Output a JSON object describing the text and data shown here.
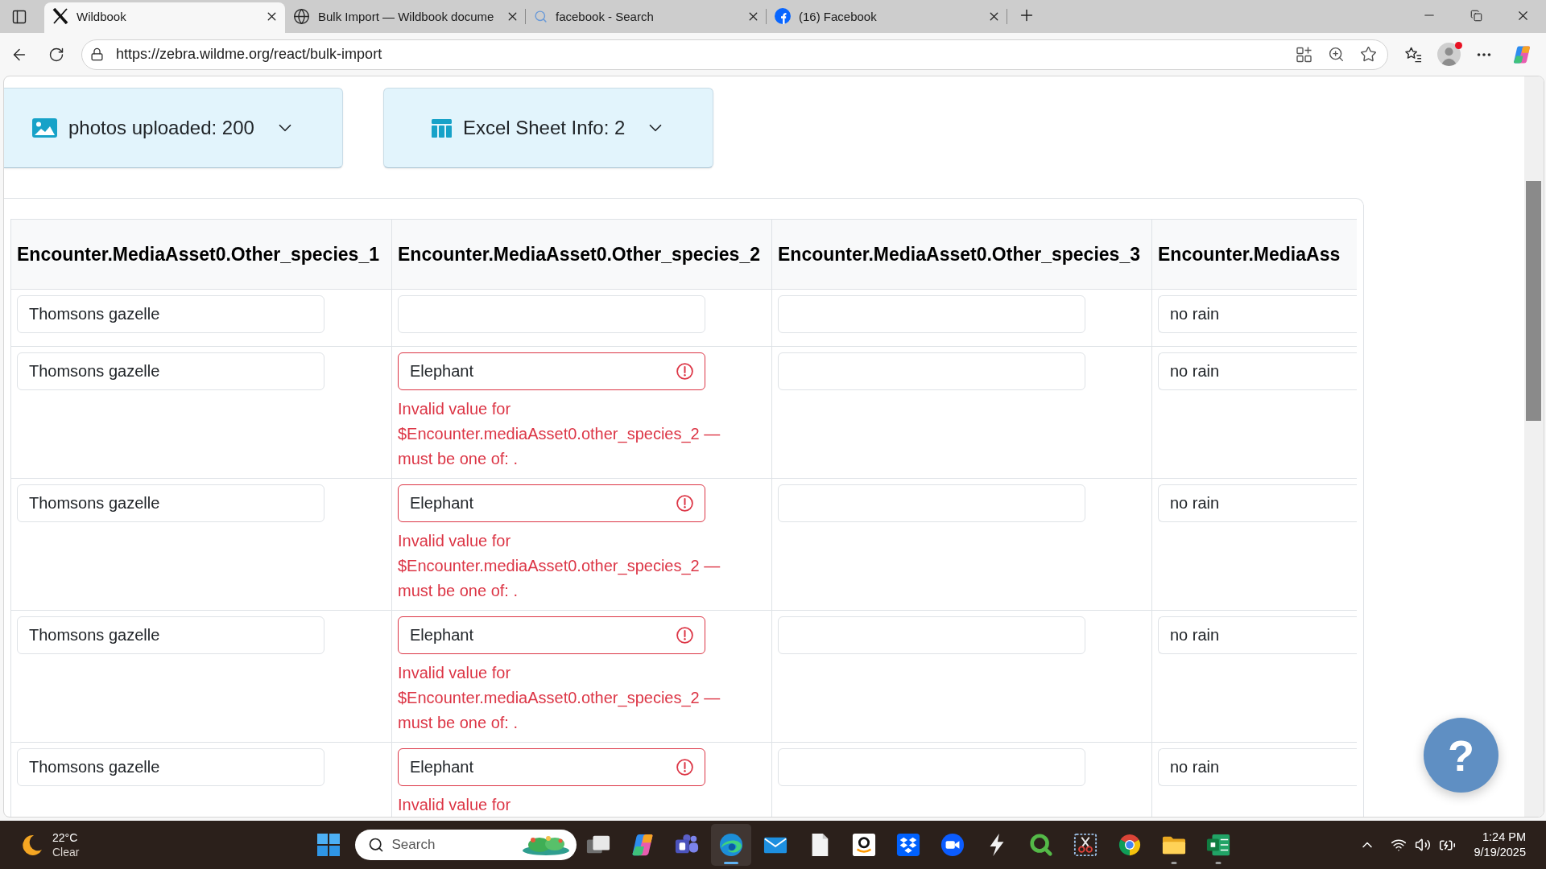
{
  "browser": {
    "tabs": [
      {
        "kind": "x",
        "title": "Wildbook",
        "selected": true
      },
      {
        "kind": "globe",
        "title": "Bulk Import — Wildbook docume",
        "selected": false
      },
      {
        "kind": "search",
        "title": "facebook - Search",
        "selected": false
      },
      {
        "kind": "facebook",
        "title": "(16) Facebook",
        "selected": false
      }
    ],
    "url": "https://zebra.wildme.org/react/bulk-import",
    "profile": {
      "notification": true
    }
  },
  "summary_cards": [
    {
      "kind": "photos",
      "label": "photos uploaded: 200",
      "expanded": false
    },
    {
      "kind": "sheet",
      "label": "Excel Sheet Info: 2",
      "expanded": false
    }
  ],
  "table": {
    "columns": [
      "Encounter.MediaAsset0.Other_species_1",
      "Encounter.MediaAsset0.Other_species_2",
      "Encounter.MediaAsset0.Other_species_3",
      "Encounter.MediaAss"
    ],
    "rows": [
      {
        "cells": [
          {
            "value": "Thomsons gazelle",
            "invalid": false
          },
          {
            "invalid": false
          },
          {
            "invalid": false
          },
          {
            "value": "no rain",
            "invalid": false
          }
        ]
      },
      {
        "cells": [
          {
            "value": "Thomsons gazelle",
            "invalid": false
          },
          {
            "value": "Elephant",
            "invalid": true,
            "error": "Invalid value for $Encounter.mediaAsset0.other_species_2 — must be one of: ."
          },
          {
            "invalid": false
          },
          {
            "value": "no rain",
            "invalid": false
          }
        ]
      },
      {
        "cells": [
          {
            "value": "Thomsons gazelle",
            "invalid": false
          },
          {
            "value": "Elephant",
            "invalid": true,
            "error": "Invalid value for $Encounter.mediaAsset0.other_species_2 — must be one of: ."
          },
          {
            "invalid": false
          },
          {
            "value": "no rain",
            "invalid": false
          }
        ]
      },
      {
        "cells": [
          {
            "value": "Thomsons gazelle",
            "invalid": false
          },
          {
            "value": "Elephant",
            "invalid": true,
            "error": "Invalid value for $Encounter.mediaAsset0.other_species_2 — must be one of: ."
          },
          {
            "invalid": false
          },
          {
            "value": "no rain",
            "invalid": false
          }
        ]
      },
      {
        "cells": [
          {
            "value": "Thomsons gazelle",
            "invalid": false
          },
          {
            "value": "Elephant",
            "invalid": true,
            "error": "Invalid value for"
          },
          {
            "invalid": false
          },
          {
            "value": "no rain",
            "invalid": false
          }
        ]
      }
    ]
  },
  "help_button": {
    "label": "?"
  },
  "taskbar": {
    "weather": {
      "temperature": "22°C",
      "condition": "Clear"
    },
    "search": {
      "placeholder": "Search"
    },
    "apps": [
      {
        "kind": "taskview",
        "running": false,
        "active": false
      },
      {
        "kind": "copilot",
        "running": false,
        "active": false
      },
      {
        "kind": "teams",
        "running": false,
        "active": false
      },
      {
        "kind": "edge",
        "running": true,
        "active": true
      },
      {
        "kind": "mail",
        "running": false,
        "active": false
      },
      {
        "kind": "file",
        "running": false,
        "active": false
      },
      {
        "kind": "amazon",
        "running": false,
        "active": false
      },
      {
        "kind": "dropbox",
        "running": false,
        "active": false
      },
      {
        "kind": "zoom",
        "running": false,
        "active": false
      },
      {
        "kind": "bolt",
        "running": false,
        "active": false
      },
      {
        "kind": "qlik",
        "running": false,
        "active": false
      },
      {
        "kind": "snip",
        "running": false,
        "active": false
      },
      {
        "kind": "chrome",
        "running": false,
        "active": false
      },
      {
        "kind": "explorer",
        "running": true,
        "active": false
      },
      {
        "kind": "excel",
        "running": true,
        "active": false
      }
    ],
    "clock": {
      "time": "1:24 PM",
      "date": "9/19/2025"
    }
  }
}
